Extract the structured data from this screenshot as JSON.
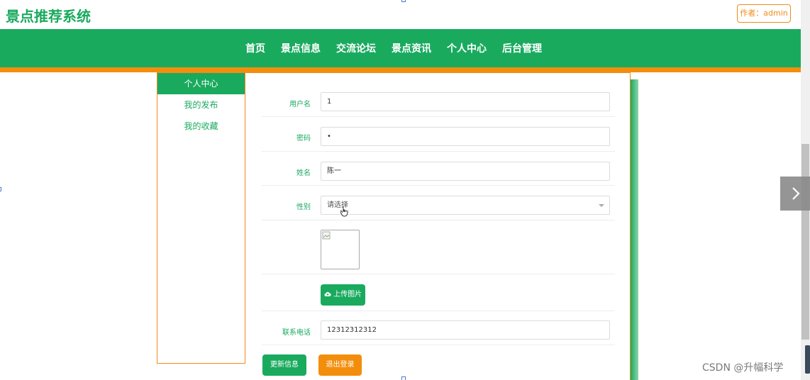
{
  "header": {
    "site_title": "景点推荐系统",
    "author_badge": "作者：admin"
  },
  "nav": {
    "items": [
      "首页",
      "景点信息",
      "交流论坛",
      "景点资讯",
      "个人中心",
      "后台管理"
    ]
  },
  "sidebar": {
    "items": [
      {
        "label": "个人中心",
        "active": true
      },
      {
        "label": "我的发布",
        "active": false
      },
      {
        "label": "我的收藏",
        "active": false
      }
    ]
  },
  "form": {
    "username": {
      "label": "用户名",
      "value": "1"
    },
    "password": {
      "label": "密码",
      "value": "•"
    },
    "name": {
      "label": "姓名",
      "value": "陈一"
    },
    "gender": {
      "label": "性别",
      "placeholder": "请选择"
    },
    "upload_button": "上传图片",
    "phone": {
      "label": "联系电话",
      "value": "12312312312"
    },
    "update_button": "更新信息",
    "logout_button": "退出登录"
  },
  "watermark": "CSDN @升幅科学",
  "colors": {
    "primary_green": "#1aaa5e",
    "accent_orange": "#f38e0c"
  }
}
